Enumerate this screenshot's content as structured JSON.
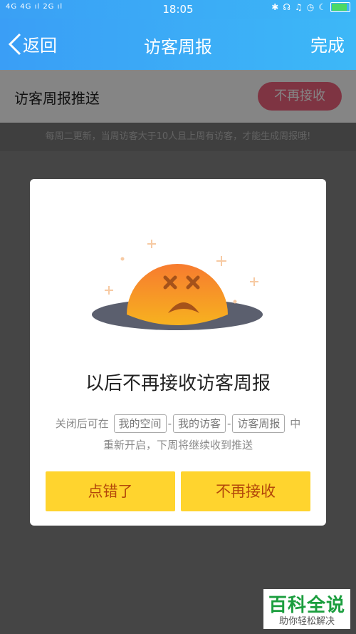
{
  "status_bar": {
    "signal_text": "4G 4G ıl  2G ıl",
    "time": "18:05"
  },
  "nav": {
    "back_label": "返回",
    "title": "访客周报",
    "done_label": "完成"
  },
  "setting": {
    "label": "访客周报推送",
    "toggle_label": "不再接收",
    "toggle_color": "#f2647f"
  },
  "hint": "每周二更新，当周访客大于10人且上周有访客，才能生成周报哦!",
  "dialog": {
    "title": "以后不再接收访客周报",
    "desc_prefix": "关闭后可在",
    "chips": [
      "我的空间",
      "我的访客",
      "访客周报"
    ],
    "desc_suffix": "中",
    "desc_line2": "重新开启，下周将继续收到推送",
    "cancel_label": "点错了",
    "confirm_label": "不再接收",
    "button_color": "#ffd42e"
  },
  "watermark": {
    "main": "百科全说",
    "sub": "助你轻松解决"
  }
}
